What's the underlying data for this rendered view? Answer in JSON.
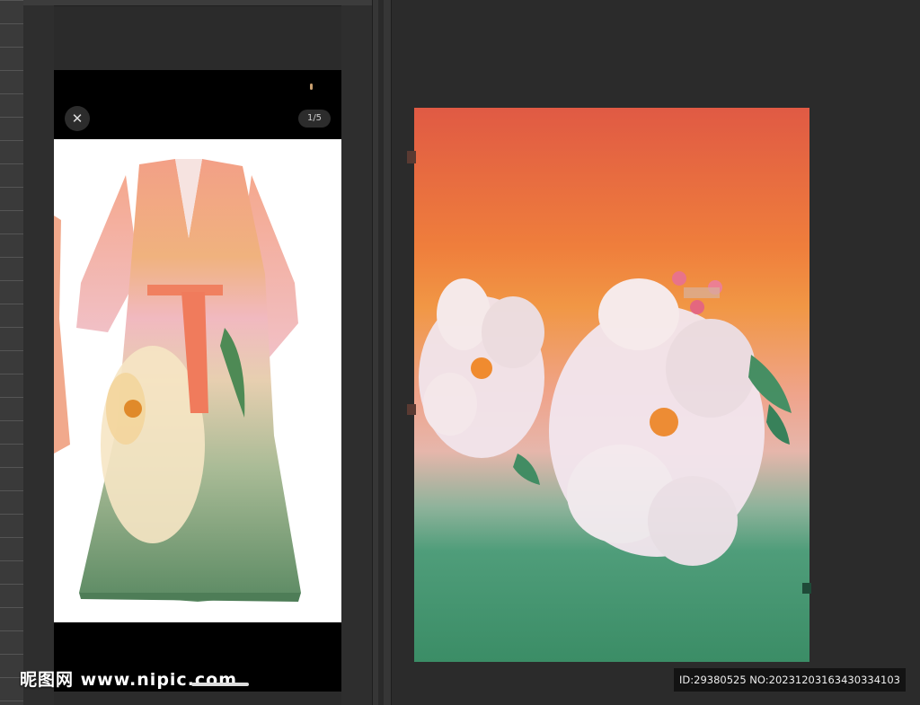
{
  "viewer": {
    "close_glyph": "✕",
    "image_counter": "1/5"
  },
  "watermark": {
    "logo_text": "昵图网 www.nipic.com",
    "id_text": "ID:29380525 NO:20231203163430334103"
  },
  "colors": {
    "canvas_bg": "#2b2b2b",
    "gradient_top": "#e05a44",
    "gradient_mid": "#f19745",
    "gradient_pink": "#e6b6ab",
    "gradient_bottom": "#3b8d66"
  }
}
